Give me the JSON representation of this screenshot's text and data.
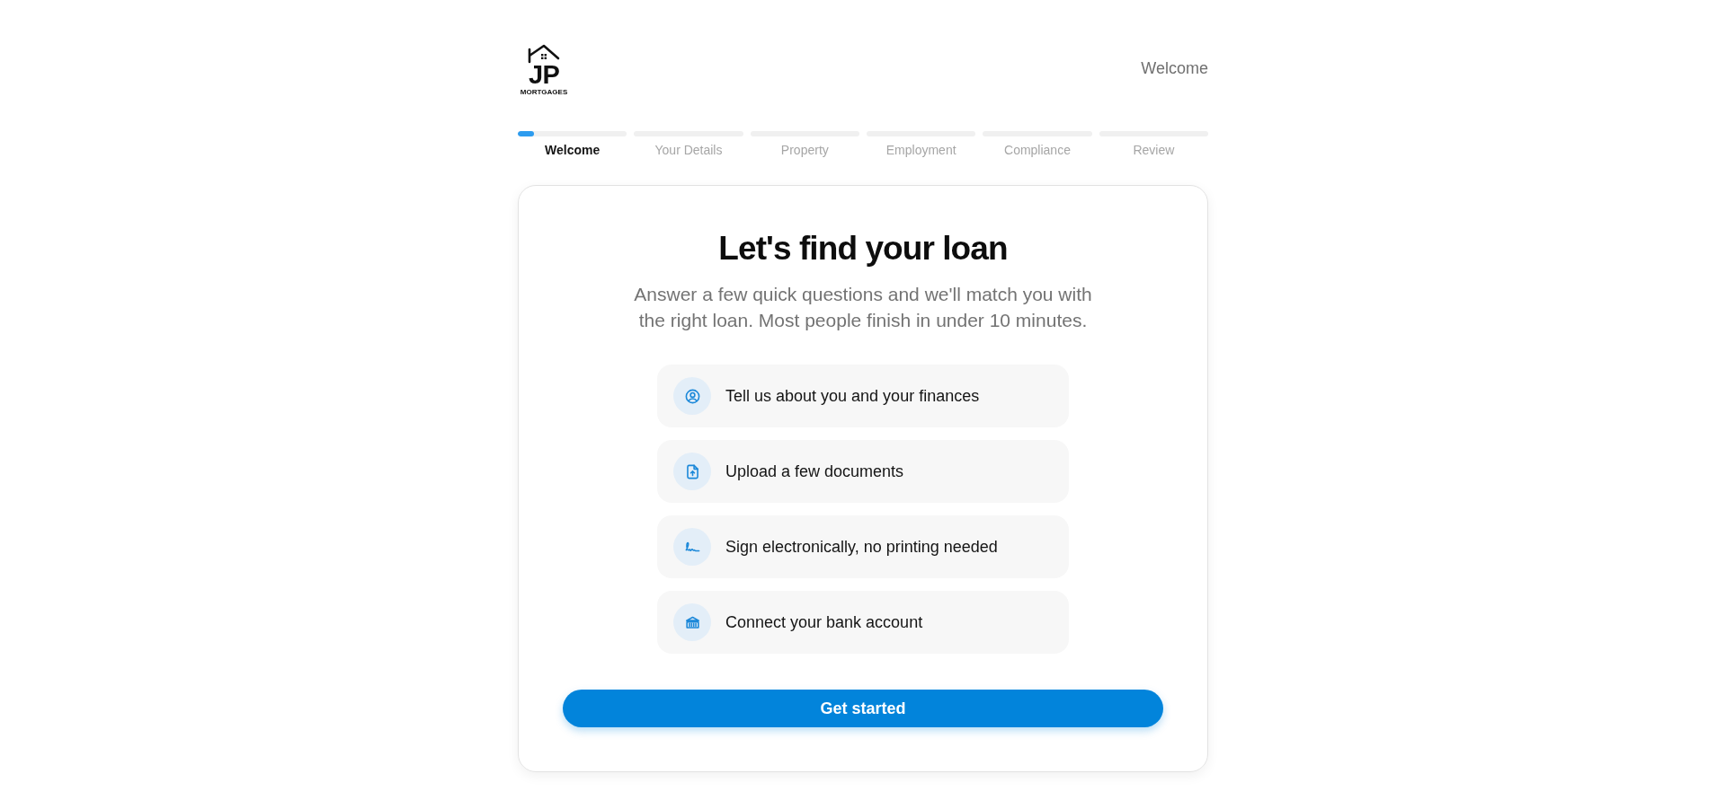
{
  "header": {
    "logo": {
      "letters": "JP",
      "tagline": "MORTGAGES"
    },
    "page_label": "Welcome"
  },
  "steps": [
    {
      "label": "Welcome",
      "selected": true,
      "level": 0.15
    },
    {
      "label": "Your Details",
      "selected": false,
      "level": 0
    },
    {
      "label": "Property",
      "selected": false,
      "level": 0
    },
    {
      "label": "Employment",
      "selected": false,
      "level": 0
    },
    {
      "label": "Compliance",
      "selected": false,
      "level": 0
    },
    {
      "label": "Review",
      "selected": false,
      "level": 0
    }
  ],
  "card": {
    "title": "Let's find your loan",
    "subtitle": "Answer a few quick questions and we'll match you with the right loan. Most people finish in under 10 minutes.",
    "items": [
      {
        "kind": "person",
        "text": "Tell us about you and your finances"
      },
      {
        "kind": "upload",
        "text": "Upload a few documents"
      },
      {
        "kind": "signature",
        "text": "Sign electronically, no printing needed"
      },
      {
        "kind": "bank",
        "text": "Connect your bank account"
      }
    ],
    "button": "Get started"
  }
}
